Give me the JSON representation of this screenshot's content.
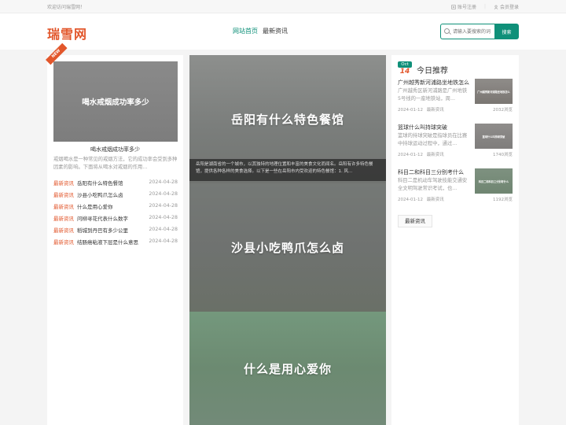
{
  "topbar": {
    "welcome": "欢迎访问瑞雪网！",
    "register": "账号注册",
    "login": "会员登录"
  },
  "header": {
    "logo": "瑞雪网",
    "nav": [
      {
        "label": "网站首页",
        "active": true
      },
      {
        "label": "最新资讯",
        "active": false
      }
    ],
    "search": {
      "placeholder": "请输入要搜索的词",
      "button": "搜索"
    }
  },
  "left": {
    "badge": "NEW",
    "feature": {
      "image_text": "喝水戒烟成功率多少",
      "title": "喝水戒烟成功率多少",
      "desc": "戒烟喝水是一种常见的戒烟方法，它的成功率会受到多种因素的影响。下面将从喝水对戒烟的作用..."
    },
    "news": [
      {
        "tag": "最新资讯",
        "title": "岳阳有什么特色餐馆",
        "date": "2024-04-28"
      },
      {
        "tag": "最新资讯",
        "title": "沙县小吃鸭爪怎么卤",
        "date": "2024-04-28"
      },
      {
        "tag": "最新资讯",
        "title": "什么是用心爱你",
        "date": "2024-04-28"
      },
      {
        "tag": "最新资讯",
        "title": "问柳寻花代表什么数字",
        "date": "2024-04-28"
      },
      {
        "tag": "最新资讯",
        "title": "稻城到丹巴有多少公里",
        "date": "2024-04-28"
      },
      {
        "tag": "最新资讯",
        "title": "结肠癌粘液下层是什么意思",
        "date": "2024-04-28"
      }
    ]
  },
  "center": {
    "slides": [
      {
        "title": "岳阳有什么特色餐馆"
      },
      {
        "title": "沙县小吃鸭爪怎么卤"
      },
      {
        "title": "什么是用心爱你"
      }
    ],
    "overlay": "岳阳是湖南省的一个城市，以其独特的地理位置和丰富的美食文化而闻名。岳阳有许多特色餐馆，提供各种各样的美食选择。以下是一些在岳阳市内受欢迎的特色餐馆：1. 风..."
  },
  "right": {
    "date": {
      "month": "Oct",
      "day": "14"
    },
    "title": "今日推荐",
    "items": [
      {
        "title": "广州越秀新河浦路坐地铁怎么",
        "desc": "广州越秀区新河浦路是广州地铁5号线的一座地铁站，周...",
        "date": "2024-01-12",
        "tag": "最新资讯",
        "views": "2032浏览",
        "thumb_text": "广州越秀新河浦路坐地铁怎么"
      },
      {
        "title": "篮球什么叫持球突破",
        "desc": "篮球的持球突破是指球员在比赛中持球运动过程中，通过...",
        "date": "2024-01-12",
        "tag": "最新资讯",
        "views": "1740浏览",
        "thumb_text": "篮球什么叫持球突破"
      },
      {
        "title": "科目二和科目三分别考什么",
        "desc": "科目二是机动车驾驶技能交通安全文明驾驶常识考试，也...",
        "date": "2024-01-12",
        "tag": "最新资讯",
        "views": "1192浏览",
        "thumb_text": "科目二和科目三分别考什么"
      }
    ],
    "latest_button": "最新资讯"
  },
  "colors": {
    "accent": "#0f9079",
    "brand": "#e2572c"
  }
}
